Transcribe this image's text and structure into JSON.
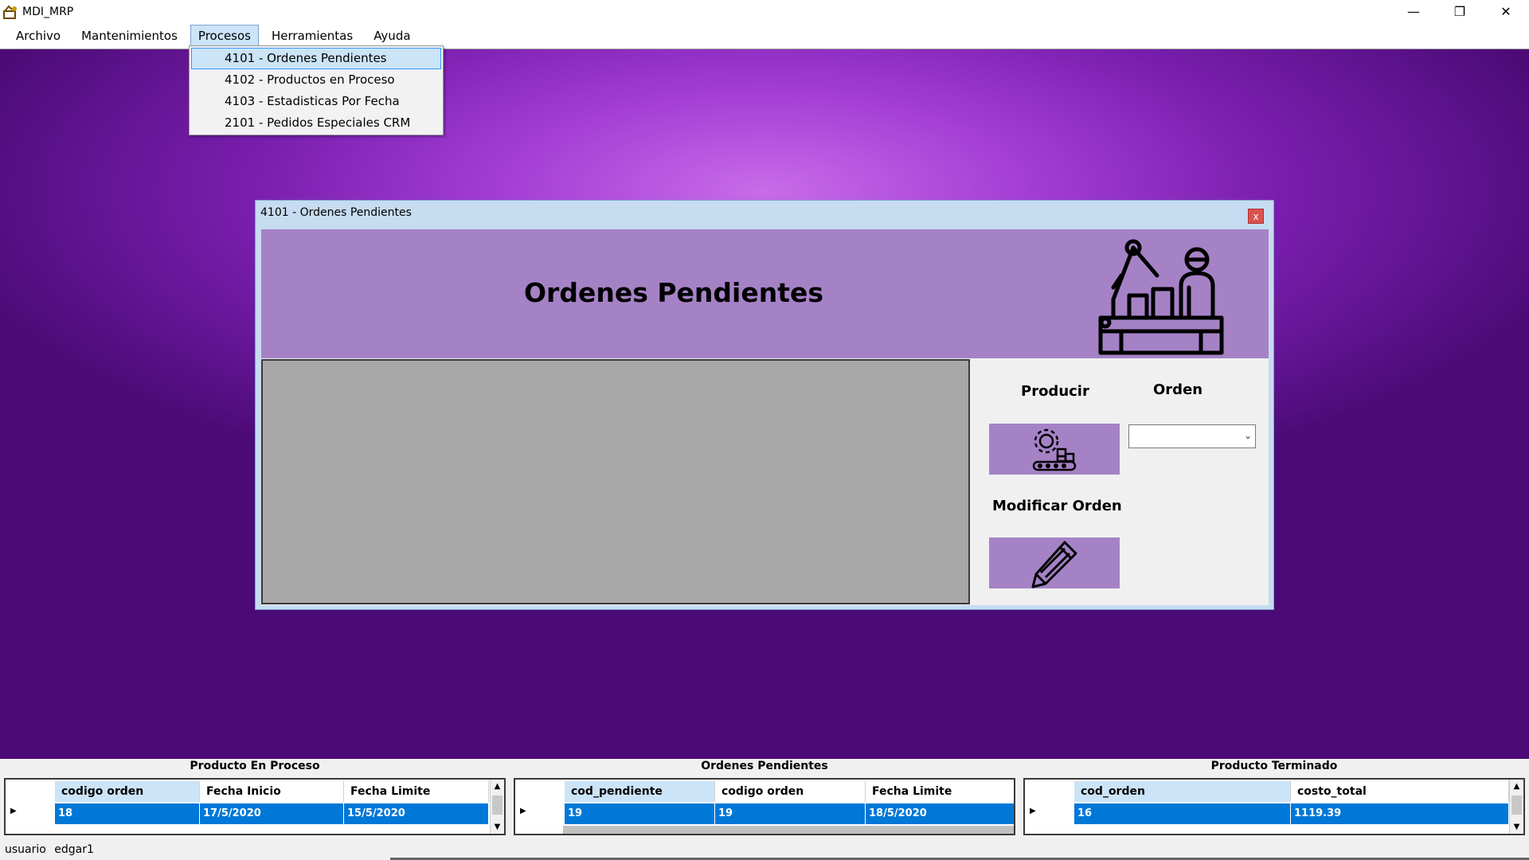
{
  "window": {
    "title": "MDI_MRP",
    "minimize": "—",
    "restore": "❐",
    "close": "✕"
  },
  "menu": {
    "items": [
      "Archivo",
      "Mantenimientos",
      "Procesos",
      "Herramientas",
      "Ayuda"
    ],
    "active_index": 2
  },
  "dropdown": {
    "items": [
      "4101 - Ordenes Pendientes",
      "4102 - Productos en Proceso",
      "4103 - Estadisticas Por Fecha",
      "2101 - Pedidos Especiales CRM"
    ],
    "highlighted_index": 0
  },
  "child_window": {
    "title": "4101 - Ordenes Pendientes",
    "close": "x",
    "header_title": "Ordenes Pendientes",
    "producir_label": "Producir",
    "orden_label": "Orden",
    "orden_value": "",
    "modificar_label": "Modificar Orden",
    "accent_color": "#a582c6"
  },
  "grids": {
    "en_proceso": {
      "title": "Producto En Proceso",
      "columns": [
        "codigo orden",
        "Fecha Inicio",
        "Fecha Limite"
      ],
      "row": [
        "18",
        "17/5/2020",
        "15/5/2020"
      ]
    },
    "pendientes": {
      "title": "Ordenes Pendientes",
      "columns": [
        "cod_pendiente",
        "codigo orden",
        "Fecha Limite"
      ],
      "row": [
        "19",
        "19",
        "18/5/2020"
      ]
    },
    "terminado": {
      "title": "Producto Terminado",
      "columns": [
        "cod_orden",
        "costo_total"
      ],
      "row": [
        "16",
        "1119.39"
      ]
    },
    "selection_color": "#0078d7"
  },
  "status": {
    "label": "usuario",
    "user": "edgar1"
  }
}
